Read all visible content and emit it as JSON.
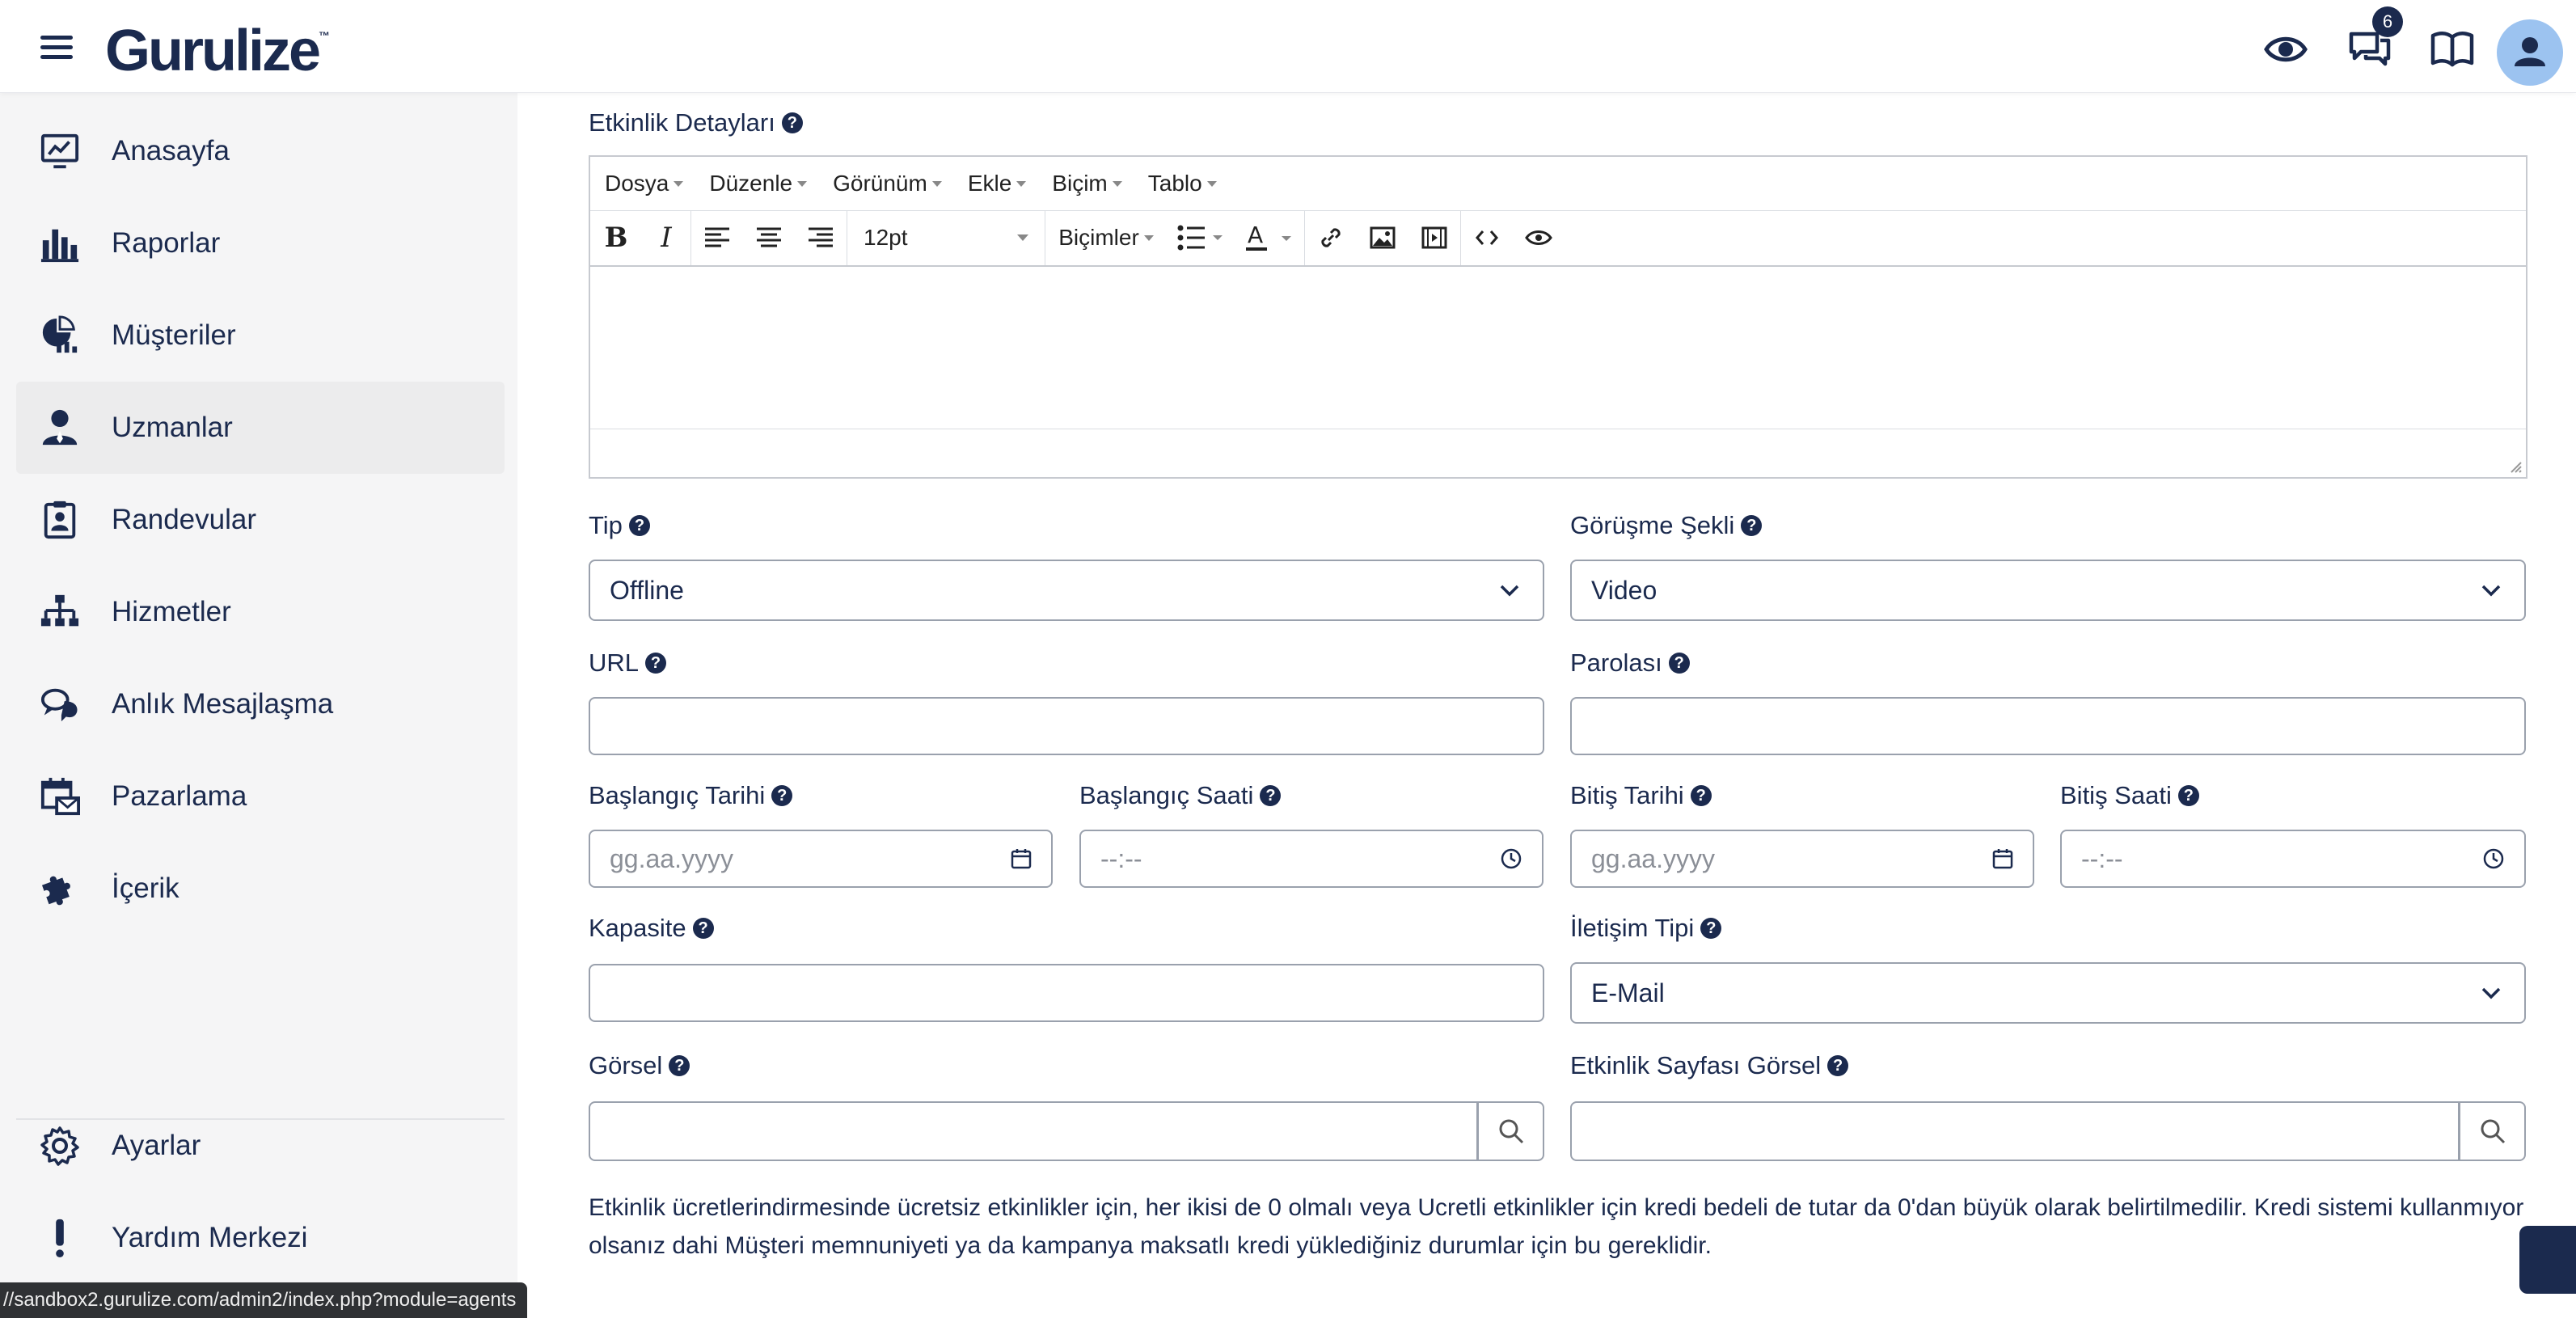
{
  "header": {
    "logo": "Gurulize",
    "logo_tm": "™",
    "notification_count": "6",
    "icons": [
      "eye-icon",
      "chat-icon",
      "book-icon",
      "user-icon"
    ]
  },
  "sidebar": {
    "items": [
      {
        "label": "Anasayfa",
        "icon": "monitor-chart-icon"
      },
      {
        "label": "Raporlar",
        "icon": "bar-chart-icon"
      },
      {
        "label": "Müşteriler",
        "icon": "pie-chart-icon"
      },
      {
        "label": "Uzmanlar",
        "icon": "user-icon",
        "active": true
      },
      {
        "label": "Randevular",
        "icon": "clipboard-user-icon"
      },
      {
        "label": "Hizmetler",
        "icon": "sitemap-icon"
      },
      {
        "label": "Anlık Mesajlaşma",
        "icon": "chat-icon"
      },
      {
        "label": "Pazarlama",
        "icon": "calendar-mail-icon"
      },
      {
        "label": "İçerik",
        "icon": "puzzle-icon"
      }
    ],
    "bottom_items": [
      {
        "label": "Ayarlar",
        "icon": "gear-icon"
      },
      {
        "label": "Yardım Merkezi",
        "icon": "exclamation-icon"
      }
    ],
    "status_url": "//sandbox2.gurulize.com/admin2/index.php?module=agents"
  },
  "form": {
    "details_label": "Etkinlik Detayları",
    "editor": {
      "menus": [
        "Dosya",
        "Düzenle",
        "Görünüm",
        "Ekle",
        "Biçim",
        "Tablo"
      ],
      "font_size": "12pt",
      "formats": "Biçimler"
    },
    "tip": {
      "label": "Tip",
      "value": "Offline"
    },
    "gorusme": {
      "label": "Görüşme Şekli",
      "value": "Video"
    },
    "url": {
      "label": "URL",
      "value": ""
    },
    "parola": {
      "label": "Parolası",
      "value": ""
    },
    "bas_tarih": {
      "label": "Başlangıç Tarihi",
      "placeholder": "gg.aa.yyyy"
    },
    "bas_saat": {
      "label": "Başlangıç Saati",
      "placeholder": "--:--"
    },
    "bit_tarih": {
      "label": "Bitiş Tarihi",
      "placeholder": "gg.aa.yyyy"
    },
    "bit_saat": {
      "label": "Bitiş Saati",
      "placeholder": "--:--"
    },
    "kapasite": {
      "label": "Kapasite",
      "value": ""
    },
    "iletisim": {
      "label": "İletişim Tipi",
      "value": "E-Mail"
    },
    "gorsel": {
      "label": "Görsel",
      "value": ""
    },
    "sayfa_gorsel": {
      "label": "Etkinlik Sayfası Görsel",
      "value": ""
    },
    "note": "Etkinlik ücretlerindirmesinde ücretsiz etkinlikler için, her ikisi de 0 olmalı veya Ucretli etkinlikler için kredi bedeli de tutar da 0'dan büyük olarak belirtilmedilir. Kredi sistemi kullanmıyor olsanız dahi Müşteri memnuniyeti ya da kampanya maksatlı kredi yüklediğiniz durumlar için bu gereklidir."
  }
}
